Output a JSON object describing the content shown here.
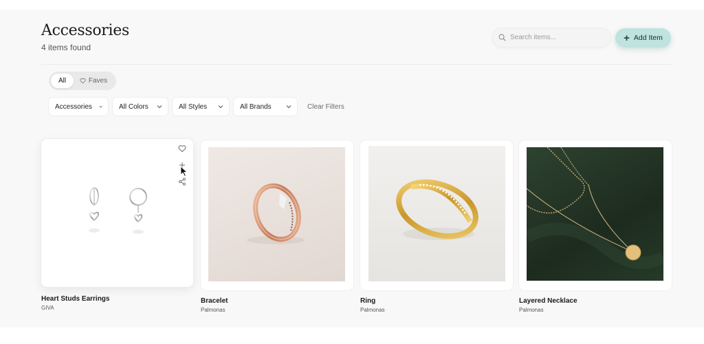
{
  "header": {
    "title": "Accessories",
    "count_label": "4 items found",
    "search_placeholder": "Search items...",
    "add_button_label": "Add Item"
  },
  "toggle": {
    "options": [
      "All",
      "Faves"
    ],
    "selected": "All"
  },
  "filters": {
    "dropdowns": [
      {
        "value": "Accessories"
      },
      {
        "value": "All Colors"
      },
      {
        "value": "All Styles"
      },
      {
        "value": "All Brands"
      }
    ],
    "clear_label": "Clear Filters"
  },
  "products": [
    {
      "name": "Heart Studs Earrings",
      "brand": "GIVA",
      "image": "silver-heart-hoop-earrings",
      "hovered": true
    },
    {
      "name": "Bracelet",
      "brand": "Palmonas",
      "image": "rose-gold-bangle"
    },
    {
      "name": "Ring",
      "brand": "Palmonas",
      "image": "gold-crossover-ring"
    },
    {
      "name": "Layered Necklace",
      "brand": "Palmonas",
      "image": "gold-layered-necklace-on-green"
    }
  ],
  "icons": {
    "search": "search-icon",
    "add": "plus-icon",
    "faves": "heart-icon",
    "dropdown": "chevron-down-icon",
    "favorite": "heart-icon",
    "add_to": "plus-icon",
    "share": "share-icon",
    "cursor": "mouse-pointer"
  },
  "colors": {
    "accent": "#bfe3df",
    "background": "#f8f8f8",
    "necklace_bg": "#243325"
  }
}
